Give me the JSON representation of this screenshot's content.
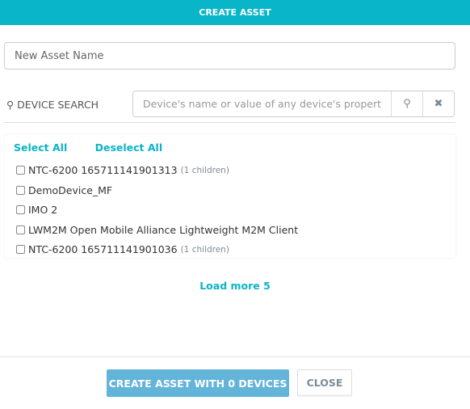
{
  "header": {
    "title": "CREATE ASSET"
  },
  "asset_name": {
    "placeholder": "New Asset Name",
    "value": ""
  },
  "search": {
    "label": "DEVICE SEARCH",
    "placeholder": "Device's name or value of any device's property",
    "value": ""
  },
  "list": {
    "select_all": "Select All",
    "deselect_all": "Deselect All",
    "items": [
      {
        "name": "NTC-6200 165711141901313",
        "children": "(1 children)",
        "checked": false
      },
      {
        "name": "DemoDevice_MF",
        "children": "",
        "checked": false
      },
      {
        "name": "IMO 2",
        "children": "",
        "checked": false
      },
      {
        "name": "LWM2M Open Mobile Alliance Lightweight M2M Client",
        "children": "",
        "checked": false
      },
      {
        "name": "NTC-6200 165711141901036",
        "children": "(1 children)",
        "checked": false
      }
    ]
  },
  "load_more": "Load more 5",
  "footer": {
    "create_label": "CREATE ASSET WITH 0 DEVICES",
    "close_label": "CLOSE"
  },
  "colors": {
    "accent": "#08b5c9",
    "primary_button": "#63b4d9"
  }
}
